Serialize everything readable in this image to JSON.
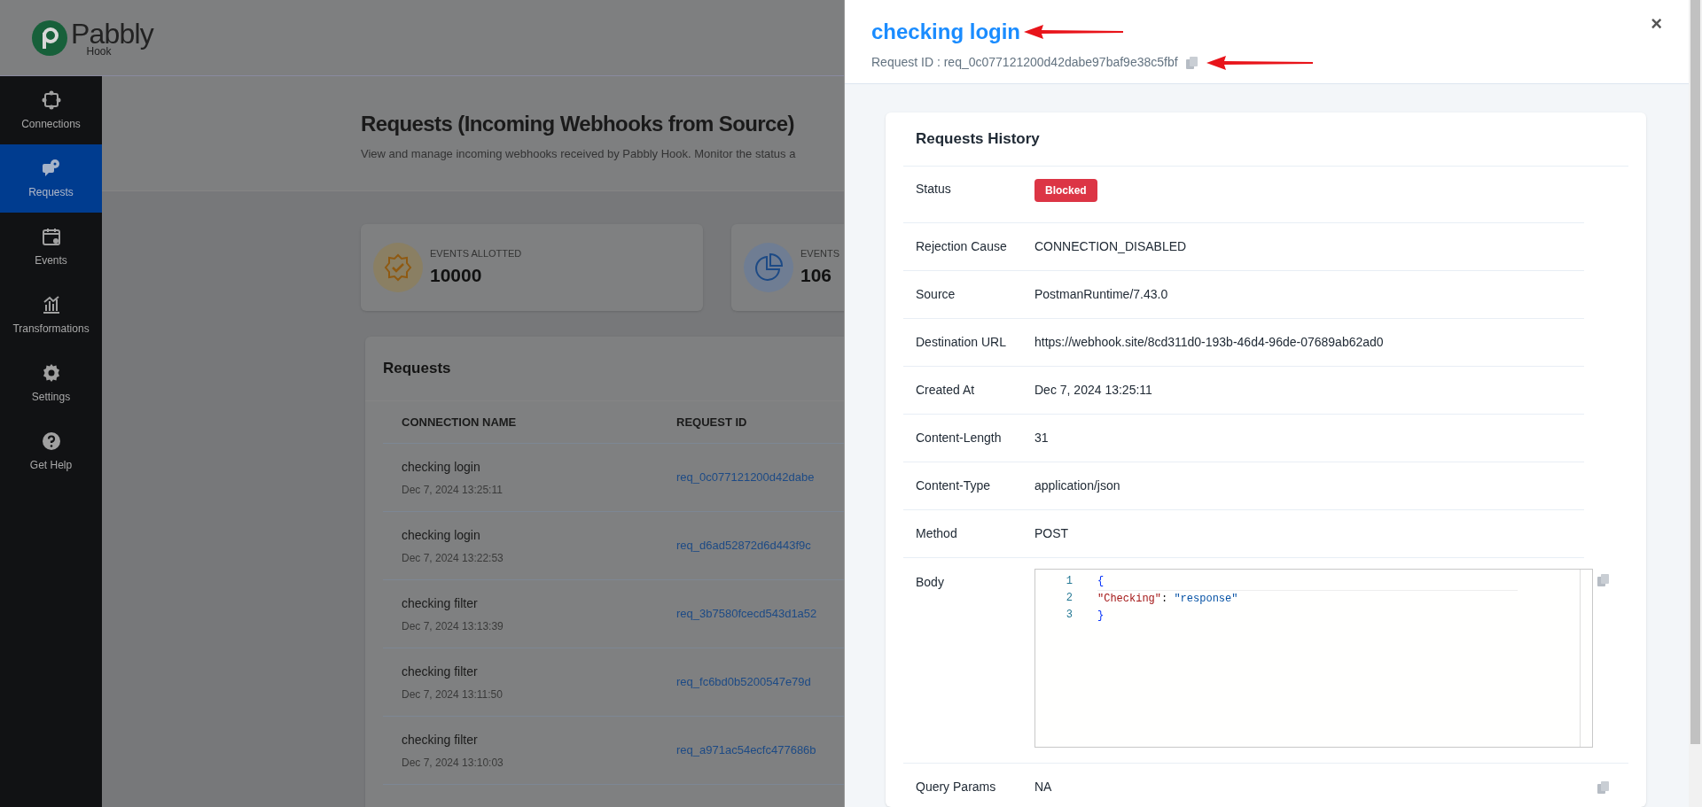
{
  "app": {
    "logo": "Pabbly",
    "logo_sub": "Hook"
  },
  "sidebar": {
    "items": [
      {
        "label": "Connections",
        "selected": false
      },
      {
        "label": "Requests",
        "selected": true
      },
      {
        "label": "Events",
        "selected": false
      },
      {
        "label": "Transformations",
        "selected": false
      },
      {
        "label": "Settings",
        "selected": false
      },
      {
        "label": "Get Help",
        "selected": false
      }
    ]
  },
  "page": {
    "title": "Requests (Incoming Webhooks from Source)",
    "subtitle": "View and manage incoming webhooks received by Pabbly Hook. Monitor the status a"
  },
  "stats": [
    {
      "label": "EVENTS ALLOTTED",
      "value": "10000"
    },
    {
      "label": "EVENTS",
      "value": "106"
    }
  ],
  "requests": {
    "title": "Requests",
    "columns": [
      "CONNECTION NAME",
      "REQUEST ID"
    ],
    "rows": [
      {
        "name": "checking login",
        "date": "Dec 7, 2024 13:25:11",
        "request_id": "req_0c077121200d42dabe"
      },
      {
        "name": "checking login",
        "date": "Dec 7, 2024 13:22:53",
        "request_id": "req_d6ad52872d6d443f9c"
      },
      {
        "name": "checking filter",
        "date": "Dec 7, 2024 13:13:39",
        "request_id": "req_3b7580fcecd543d1a52"
      },
      {
        "name": "checking filter",
        "date": "Dec 7, 2024 13:11:50",
        "request_id": "req_fc6bd0b5200547e79d"
      },
      {
        "name": "checking filter",
        "date": "Dec 7, 2024 13:10:03",
        "request_id": "req_a971ac54ecfc477686b"
      }
    ]
  },
  "drawer": {
    "title": "checking login",
    "request_id": "Request ID : req_0c077121200d42dabe97baf9e38c5fbf",
    "close": "×",
    "history": {
      "title": "Requests History",
      "rows": [
        {
          "label": "Status",
          "kind": "badge",
          "value": "Blocked"
        },
        {
          "label": "Rejection Cause",
          "kind": "text",
          "value": "CONNECTION_DISABLED"
        },
        {
          "label": "Source",
          "kind": "text",
          "value": "PostmanRuntime/7.43.0"
        },
        {
          "label": "Destination URL",
          "kind": "text",
          "value": "https://webhook.site/8cd311d0-193b-46d4-96de-07689ab62ad0"
        },
        {
          "label": "Created At",
          "kind": "text",
          "value": "Dec 7, 2024 13:25:11"
        },
        {
          "label": "Content-Length",
          "kind": "text",
          "value": "31"
        },
        {
          "label": "Content-Type",
          "kind": "text",
          "value": "application/json"
        },
        {
          "label": "Method",
          "kind": "text",
          "value": "POST"
        },
        {
          "label": "Body",
          "kind": "code",
          "lines": [
            {
              "num": "1",
              "tokens": [
                {
                  "kind": "punct",
                  "text": "{"
                }
              ]
            },
            {
              "num": "2",
              "tokens": [
                {
                  "kind": "key",
                  "text": "\"Checking\""
                },
                {
                  "kind": "plain",
                  "text": ": "
                },
                {
                  "kind": "string",
                  "text": "\"response\""
                }
              ]
            },
            {
              "num": "3",
              "tokens": [
                {
                  "kind": "punct",
                  "text": "}"
                }
              ]
            }
          ]
        },
        {
          "label": "Query Params",
          "kind": "copytext",
          "value": "NA"
        }
      ]
    }
  }
}
